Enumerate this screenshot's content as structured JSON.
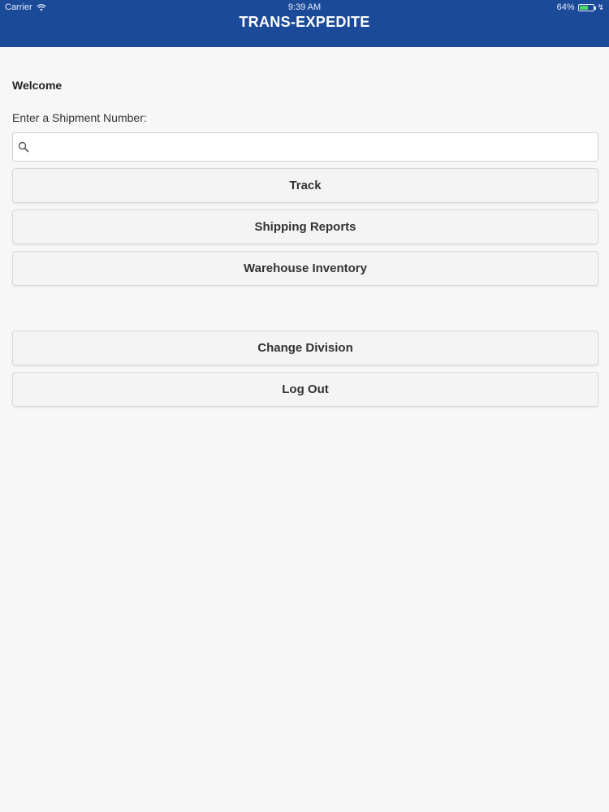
{
  "status_bar": {
    "carrier": "Carrier",
    "time": "9:39 AM",
    "battery": "64%",
    "battery_level": 0.64
  },
  "header": {
    "title": "TRANS-EXPEDITE"
  },
  "main": {
    "welcome": "Welcome",
    "prompt": "Enter a Shipment Number:",
    "search": {
      "value": "",
      "placeholder": ""
    },
    "buttons": {
      "track": "Track",
      "shipping_reports": "Shipping Reports",
      "warehouse_inventory": "Warehouse Inventory",
      "change_division": "Change Division",
      "log_out": "Log Out"
    }
  },
  "colors": {
    "header_bg": "#1b4a99",
    "page_bg": "#f7f7f7",
    "button_bg": "#f4f4f4"
  }
}
